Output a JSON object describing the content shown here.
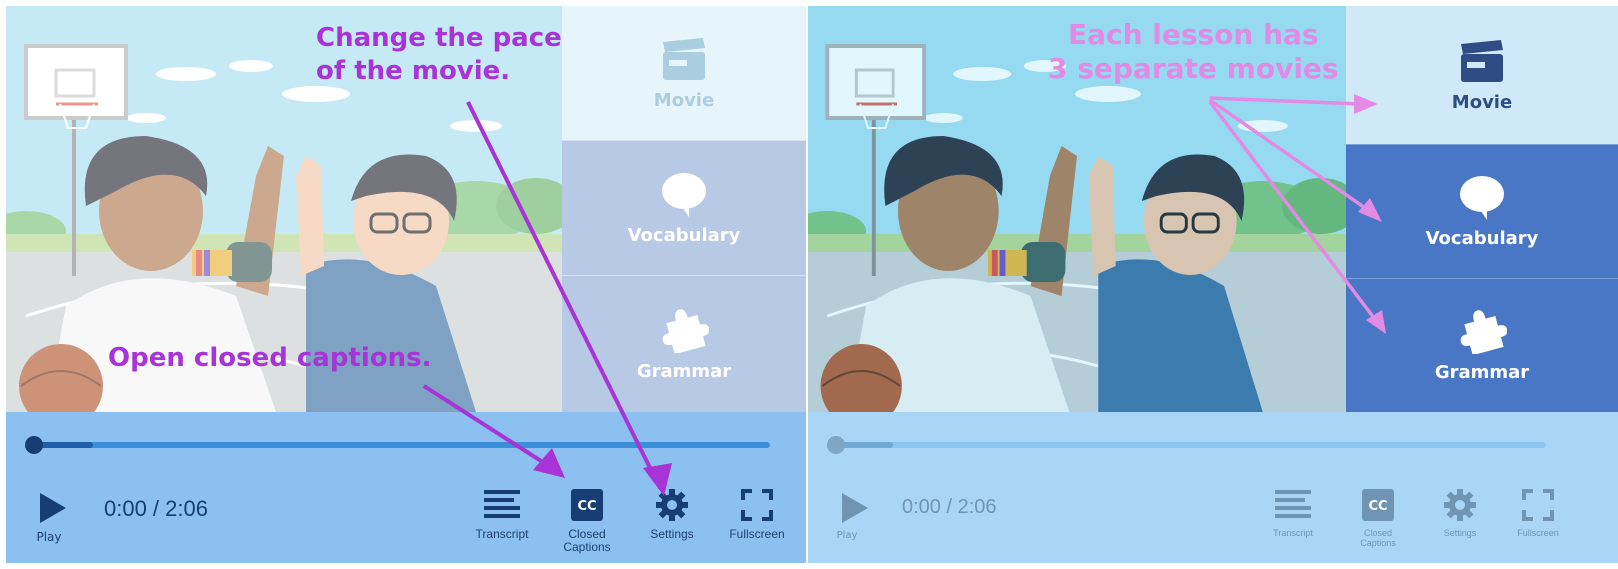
{
  "left_panel": {
    "side_menu": {
      "items": [
        {
          "label": "Movie",
          "icon": "clapperboard-icon"
        },
        {
          "label": "Vocabulary",
          "icon": "speech-bubble-icon"
        },
        {
          "label": "Grammar",
          "icon": "puzzle-piece-icon"
        }
      ],
      "active": "Movie"
    },
    "player": {
      "play_label": "Play",
      "time": "0:00 / 2:06",
      "progress": 0.0,
      "buffered": 0.08,
      "controls": [
        {
          "label": "Transcript",
          "icon": "transcript-icon"
        },
        {
          "label": "Closed\nCaptions",
          "icon": "closed-captions-icon"
        },
        {
          "label": "Settings",
          "icon": "gear-icon"
        },
        {
          "label": "Fullscreen",
          "icon": "fullscreen-icon"
        }
      ]
    },
    "annotations": {
      "pace": "Change the pace\nof the movie.",
      "captions": "Open closed captions."
    }
  },
  "right_panel": {
    "side_menu": {
      "items": [
        {
          "label": "Movie",
          "icon": "clapperboard-icon"
        },
        {
          "label": "Vocabulary",
          "icon": "speech-bubble-icon"
        },
        {
          "label": "Grammar",
          "icon": "puzzle-piece-icon"
        }
      ],
      "active": "Movie"
    },
    "player": {
      "play_label": "Play",
      "time": "0:00 / 2:06",
      "progress": 0.0,
      "buffered": 0.08,
      "controls": [
        {
          "label": "Transcript",
          "icon": "transcript-icon"
        },
        {
          "label": "Closed\nCaptions",
          "icon": "closed-captions-icon"
        },
        {
          "label": "Settings",
          "icon": "gear-icon"
        },
        {
          "label": "Fullscreen",
          "icon": "fullscreen-icon"
        }
      ]
    },
    "annotations": {
      "lessons": "Each lesson has\n3 separate movies"
    }
  },
  "colors": {
    "annotation_purple": "#a833d6",
    "annotation_pink": "#e28ae4",
    "menu_active_blue": "#4a77c5",
    "controls_bar": "#8cc0f0"
  }
}
